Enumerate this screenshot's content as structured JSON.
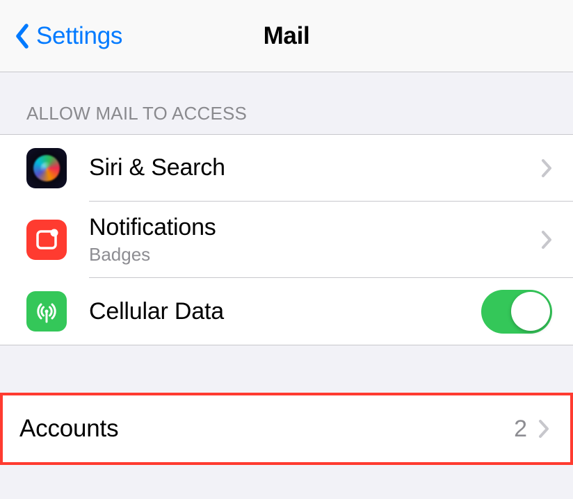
{
  "navbar": {
    "back_label": "Settings",
    "title": "Mail"
  },
  "sections": {
    "allow_access": {
      "header": "ALLOW MAIL TO ACCESS",
      "rows": {
        "siri": {
          "label": "Siri & Search"
        },
        "notifications": {
          "label": "Notifications",
          "sublabel": "Badges"
        },
        "cellular": {
          "label": "Cellular Data",
          "toggle_on": true
        }
      }
    },
    "accounts": {
      "rows": {
        "accounts": {
          "label": "Accounts",
          "value": "2"
        }
      }
    }
  }
}
